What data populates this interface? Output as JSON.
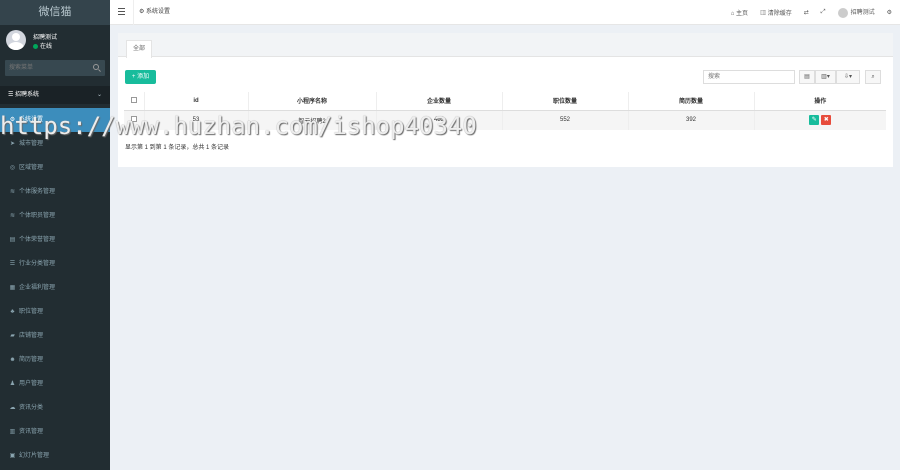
{
  "sidebar": {
    "brand": "微信猫",
    "user": {
      "name": "招聘测试",
      "status": "在线"
    },
    "search_placeholder": "搜索菜单",
    "section": "招聘系统",
    "items": [
      {
        "label": "系统设置",
        "icon": "gears-icon",
        "glyph": "⚙"
      },
      {
        "label": "城市管理",
        "icon": "send-icon",
        "glyph": "➤"
      },
      {
        "label": "区域管理",
        "icon": "globe-icon",
        "glyph": "◎"
      },
      {
        "label": "个体服务管理",
        "icon": "rss-icon",
        "glyph": "≋"
      },
      {
        "label": "个体职员管理",
        "icon": "rss-icon",
        "glyph": "≋"
      },
      {
        "label": "个体荣誉管理",
        "icon": "list-alt-icon",
        "glyph": "▤"
      },
      {
        "label": "行业分类管理",
        "icon": "list-icon",
        "glyph": "☰"
      },
      {
        "label": "企业福利管理",
        "icon": "table-icon",
        "glyph": "▦"
      },
      {
        "label": "职位管理",
        "icon": "sitemap-icon",
        "glyph": "♣"
      },
      {
        "label": "店铺管理",
        "icon": "folder-icon",
        "glyph": "▰"
      },
      {
        "label": "简历管理",
        "icon": "users-icon",
        "glyph": "☻"
      },
      {
        "label": "用户管理",
        "icon": "user-icon",
        "glyph": "♟"
      },
      {
        "label": "资讯分类",
        "icon": "cloud-icon",
        "glyph": "☁"
      },
      {
        "label": "资讯管理",
        "icon": "newspaper-icon",
        "glyph": "▥"
      },
      {
        "label": "幻灯片管理",
        "icon": "image-icon",
        "glyph": "▣"
      }
    ]
  },
  "topbar": {
    "current_tab": "系统设置",
    "home": "主页",
    "clear_cache": "清除缓存",
    "username": "招聘测试"
  },
  "main": {
    "tab_all": "全部",
    "add_button": "+ 添加",
    "search_placeholder": "搜索",
    "toolbar": {
      "b1": "▤",
      "b2": "▥▾",
      "b3": "⇩▾",
      "b4": "⌕"
    },
    "columns": [
      "id",
      "小程序名称",
      "企业数量",
      "职位数量",
      "简历数量",
      "操作"
    ],
    "rows": [
      {
        "id": "53",
        "name": "智云招聘2",
        "companies": "453",
        "jobs": "552",
        "resumes": "392"
      }
    ],
    "pager": "显示第 1 到第 1 条记录，总共 1 条记录"
  },
  "watermark": "https://www.huzhan.com/ishop40340",
  "colors": {
    "sidebar_bg": "#222d32",
    "active": "#3c8dbc",
    "add_btn": "#18bc9c",
    "delete_btn": "#e74c3c"
  }
}
